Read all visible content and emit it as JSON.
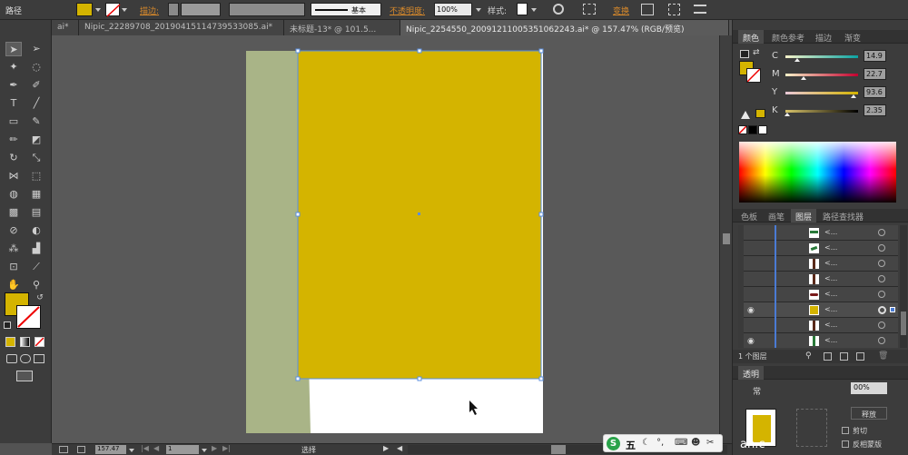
{
  "app": {
    "path_label": "路径"
  },
  "control_bar": {
    "stroke_label": "描边:",
    "stroke_profile": "基本",
    "opacity_label": "不透明度:",
    "opacity_value": "100%",
    "style_label": "样式:",
    "transform_label": "变换"
  },
  "tabs": [
    {
      "label": "ai*"
    },
    {
      "label": "Nipic_22289708_20190415114739533085.ai*"
    },
    {
      "label": "未标题-13* @ 101.5..."
    },
    {
      "label": "Nipic_2254550_20091211005351062243.ai* @ 157.47% (RGB/预览)"
    }
  ],
  "color_panel": {
    "tabs": [
      {
        "label": "颜色"
      },
      {
        "label": "颜色参考"
      },
      {
        "label": "描边"
      },
      {
        "label": "渐变"
      }
    ],
    "channels": [
      {
        "name": "C",
        "value": "14.9"
      },
      {
        "name": "M",
        "value": "22.7"
      },
      {
        "name": "Y",
        "value": "93.6"
      },
      {
        "name": "K",
        "value": "2.35"
      }
    ],
    "fill_color": "#d4b400"
  },
  "layers_panel": {
    "tabs": [
      {
        "label": "色板"
      },
      {
        "label": "画笔"
      },
      {
        "label": "图层"
      },
      {
        "label": "路径查找器"
      }
    ],
    "rows": [
      {
        "label": "<..."
      },
      {
        "label": "<..."
      },
      {
        "label": "<..."
      },
      {
        "label": "<..."
      },
      {
        "label": "<..."
      },
      {
        "label": "<..."
      },
      {
        "label": "<..."
      },
      {
        "label": "<..."
      }
    ],
    "footer_label": "1 个图层"
  },
  "transparency_panel": {
    "title": "透明",
    "mode_prefix": "常",
    "opacity_value": "00%",
    "make_mask_label": "释放",
    "clip_label": "剪切",
    "invert_mask_label": "反相蒙版"
  },
  "status_bar": {
    "zoom": "157.47",
    "page": "1",
    "tool_name": "选择"
  },
  "ime": {
    "logo": "S",
    "label": "五"
  },
  "watermark": {
    "text": "an.c"
  },
  "colors": {
    "fill": "#d4b400",
    "panel_bg": "#3c3c3c",
    "canvas_bg": "#595959",
    "accent_orange": "#d98a2b",
    "olive": "#a9b487"
  }
}
